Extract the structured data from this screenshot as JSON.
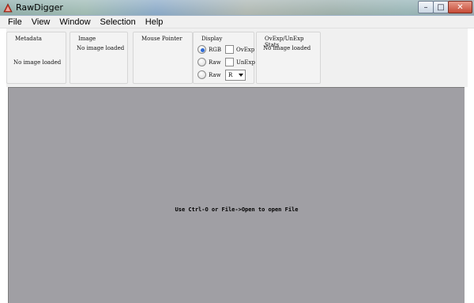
{
  "window": {
    "title": "RawDigger",
    "icons": {
      "app": "rawdigger-triangle-icon",
      "minimize": "minimize-icon",
      "maximize": "maximize-icon",
      "close": "close-icon"
    },
    "controls": {
      "minimize": "–",
      "maximize": "□",
      "close": "✕"
    }
  },
  "menu": [
    "File",
    "View",
    "Window",
    "Selection",
    "Help"
  ],
  "panels": {
    "metadata": {
      "title": "Metadata",
      "text": "No image loaded"
    },
    "image": {
      "title": "Image",
      "text": "No image loaded"
    },
    "mouse_pointer": {
      "title": "Mouse Pointer"
    },
    "display": {
      "title": "Display",
      "radios": [
        {
          "label": "RGB",
          "checked": true
        },
        {
          "label": "Raw",
          "checked": false
        },
        {
          "label": "Raw",
          "checked": false
        }
      ],
      "checkboxes": [
        {
          "label": "OvExp",
          "checked": false
        },
        {
          "label": "UnExp",
          "checked": false
        }
      ],
      "channel_select": {
        "value": "R"
      }
    },
    "ovexp_stats": {
      "title": "OvExp/UnExp Stats",
      "text": "No image loaded"
    }
  },
  "viewer": {
    "message": "Use Ctrl-O or File->Open to open File"
  },
  "colors": {
    "viewer_bg": "#a09fa4",
    "radio_checked": "#2e6ad6",
    "close_button": "#c64b36"
  }
}
